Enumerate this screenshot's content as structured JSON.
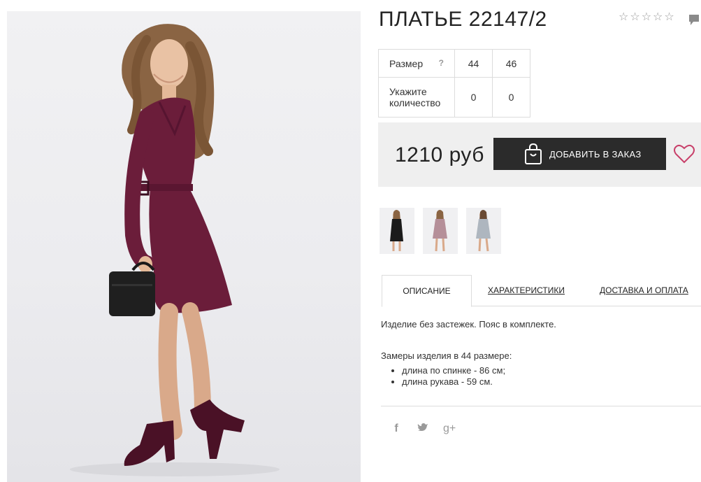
{
  "product": {
    "title": "ПЛАТЬЕ 22147/2",
    "rating_stars": [
      "☆",
      "☆",
      "☆",
      "☆",
      "☆"
    ]
  },
  "size_table": {
    "size_label": "Размер",
    "help_mark": "?",
    "sizes": [
      "44",
      "46"
    ],
    "qty_label": "Укажите количество",
    "qty_values": [
      "0",
      "0"
    ]
  },
  "purchase": {
    "price": "1210 руб",
    "add_button_label": "ДОБАВИТЬ В ЗАКАЗ"
  },
  "tabs": [
    {
      "label": "ОПИСАНИЕ"
    },
    {
      "label": "ХАРАКТЕРИСТИКИ"
    },
    {
      "label": "ДОСТАВКА И ОПЛАТА"
    }
  ],
  "description": {
    "intro": "Изделие без застежек. Пояс в комплекте.",
    "measurements_title": "Замеры изделия в 44 размере:",
    "measurements": [
      "длина по спинке - 86 см;",
      "длина рукава - 59 см."
    ]
  },
  "social": {
    "facebook": "f",
    "twitter": "🐦",
    "google_plus": "g+"
  },
  "colors": {
    "dress": "#6b1d3a",
    "button_bg": "#2b2b2b",
    "heart": "#c8406a",
    "price_bg": "#efefef"
  },
  "icons": [
    "star-icon",
    "comment-icon",
    "shopping-bag-icon",
    "heart-icon",
    "facebook-icon",
    "twitter-icon",
    "google-plus-icon"
  ]
}
